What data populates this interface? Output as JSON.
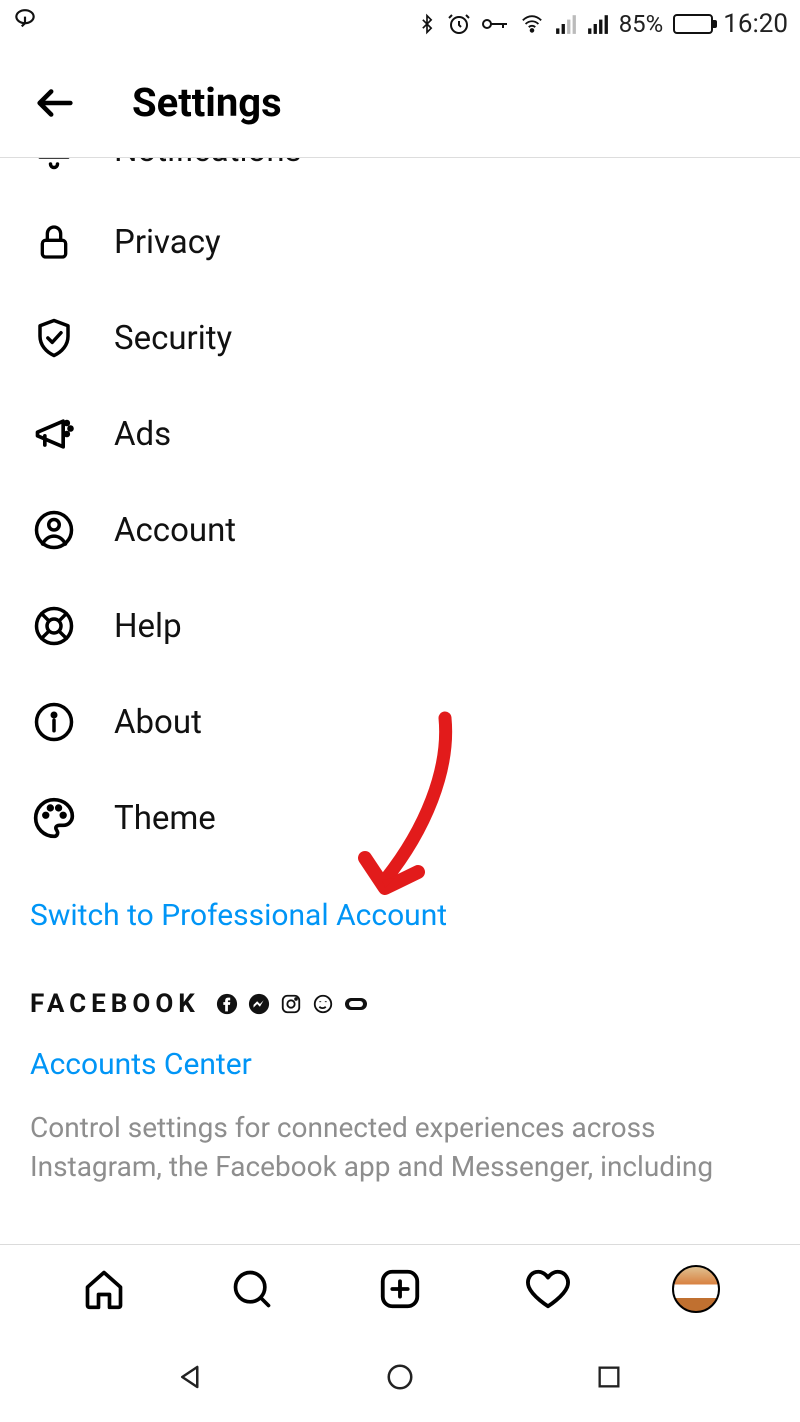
{
  "status": {
    "battery_text": "85%",
    "time": "16:20"
  },
  "header": {
    "title": "Settings"
  },
  "settings": {
    "items": [
      {
        "id": "notifications",
        "label": "Notifications",
        "icon": "bell-icon"
      },
      {
        "id": "privacy",
        "label": "Privacy",
        "icon": "lock-icon"
      },
      {
        "id": "security",
        "label": "Security",
        "icon": "shield-check-icon"
      },
      {
        "id": "ads",
        "label": "Ads",
        "icon": "megaphone-icon"
      },
      {
        "id": "account",
        "label": "Account",
        "icon": "user-circle-icon"
      },
      {
        "id": "help",
        "label": "Help",
        "icon": "lifebuoy-icon"
      },
      {
        "id": "about",
        "label": "About",
        "icon": "info-icon"
      },
      {
        "id": "theme",
        "label": "Theme",
        "icon": "palette-icon"
      }
    ]
  },
  "switch_link": "Switch to Professional Account",
  "facebook": {
    "title": "FACEBOOK",
    "accounts_center": "Accounts Center",
    "description": "Control settings for connected experiences across Instagram, the Facebook app and Messenger, including"
  },
  "annotation": {
    "color": "#e21b1b"
  }
}
